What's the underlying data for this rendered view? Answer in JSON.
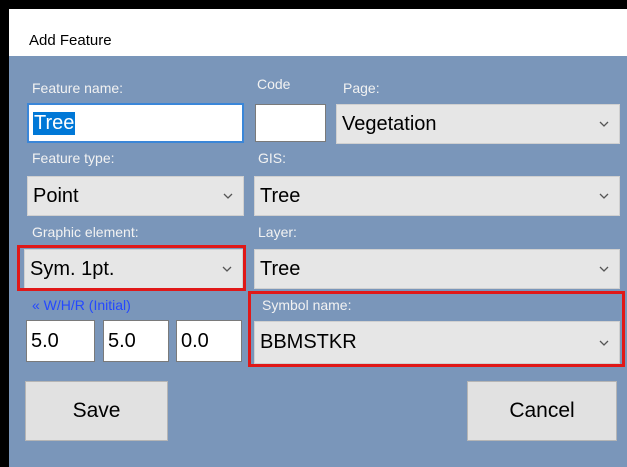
{
  "window": {
    "title": "Add Feature"
  },
  "feature_name": {
    "label": "Feature name:",
    "value": "Tree"
  },
  "code": {
    "label": "Code",
    "value": ""
  },
  "page": {
    "label": "Page:",
    "value": "Vegetation"
  },
  "feature_type": {
    "label": "Feature type:",
    "value": "Point"
  },
  "gis": {
    "label": "GIS:",
    "value": "Tree"
  },
  "graphic_element": {
    "label": "Graphic element:",
    "value": "Sym. 1pt."
  },
  "layer": {
    "label": "Layer:",
    "value": "Tree"
  },
  "whr": {
    "label": "« W/H/R (Initial)",
    "w": "5.0",
    "h": "5.0",
    "r": "0.0"
  },
  "symbol_name": {
    "label": "Symbol name:",
    "value": "BBMSTKR"
  },
  "buttons": {
    "save": "Save",
    "cancel": "Cancel"
  },
  "colors": {
    "dialog_bg": "#7a96ba",
    "highlight_box": "#e01818",
    "link_label": "#2448ff"
  },
  "icons": {
    "dropdown": "chevron-down-icon"
  }
}
